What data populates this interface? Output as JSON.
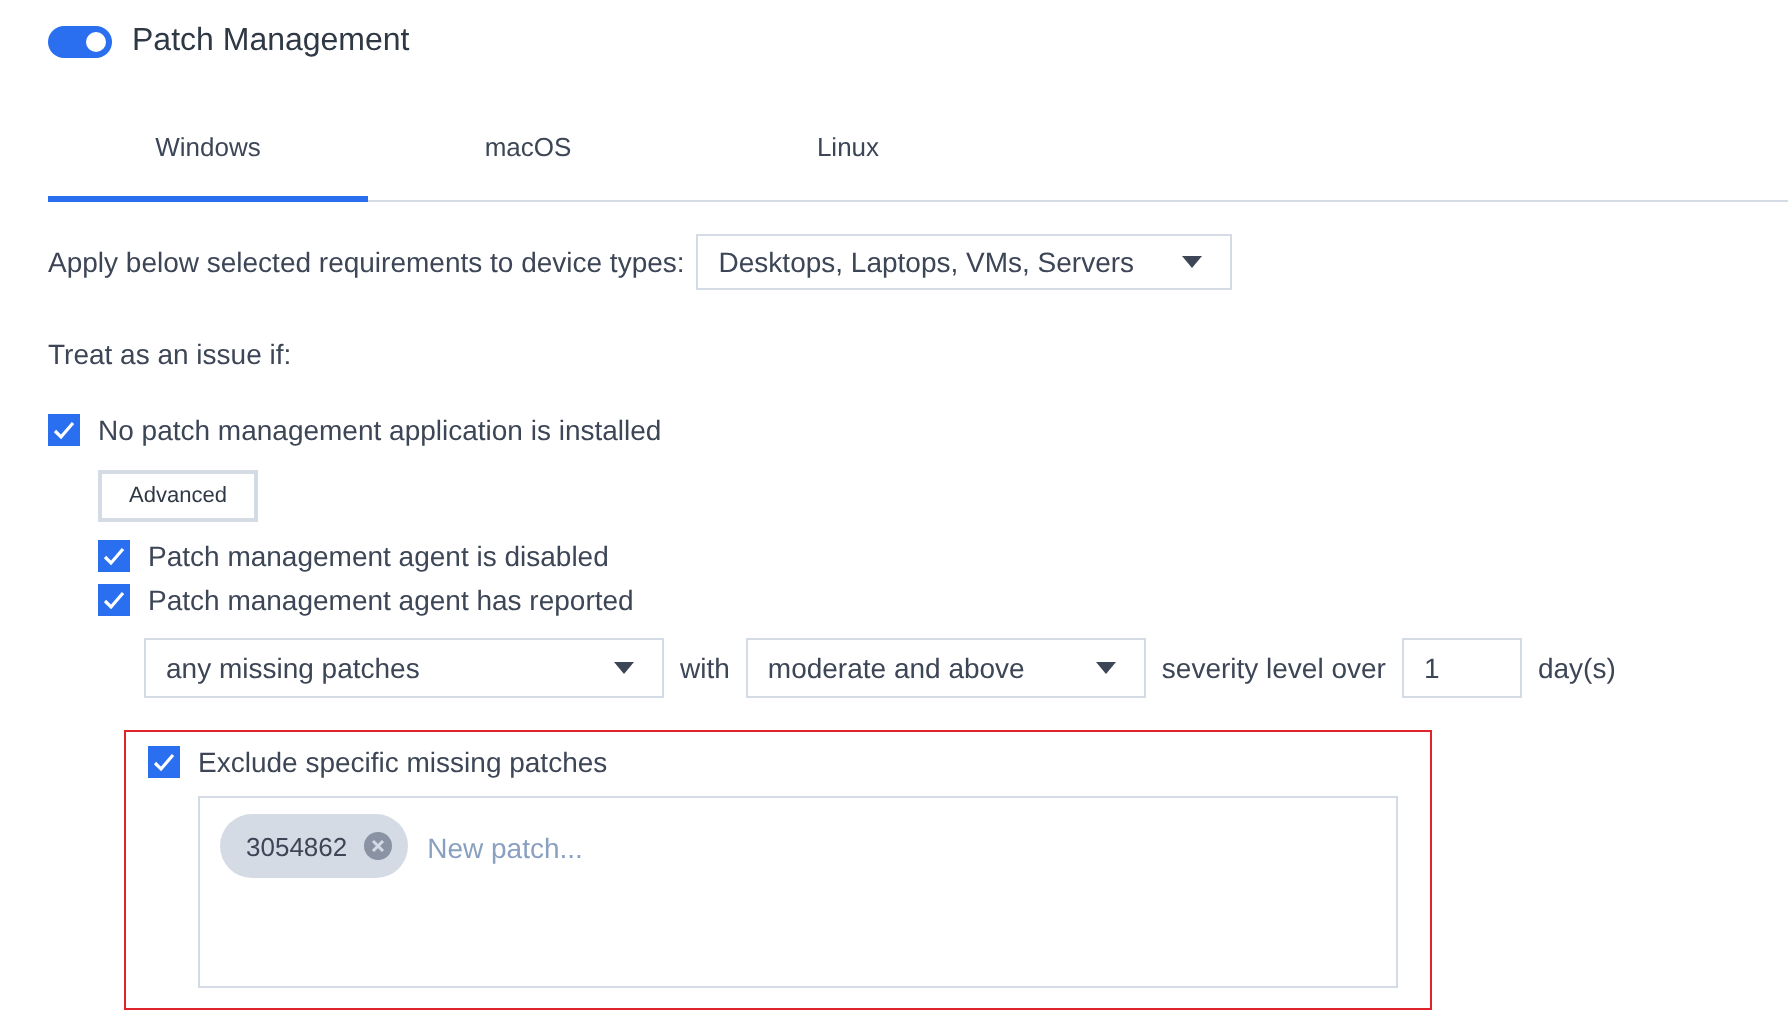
{
  "header": {
    "toggle_on": true,
    "title": "Patch Management"
  },
  "tabs": [
    {
      "label": "Windows",
      "selected": true
    },
    {
      "label": "macOS",
      "selected": false
    },
    {
      "label": "Linux",
      "selected": false
    }
  ],
  "device_types": {
    "label": "Apply below selected requirements to device types:",
    "value": "Desktops, Laptops, VMs, Servers"
  },
  "treat_label": "Treat as an issue if:",
  "main_check": {
    "label": "No patch management application is installed",
    "checked": true
  },
  "advanced_button": "Advanced",
  "sub_checks": [
    {
      "label": "Patch management agent is disabled",
      "checked": true
    },
    {
      "label": "Patch management agent has reported",
      "checked": true
    }
  ],
  "condition": {
    "patches_select": "any missing patches",
    "with": "with",
    "severity_select": "moderate and above",
    "severity_label": "severity level over",
    "days_value": "1",
    "days_unit": "day(s)"
  },
  "exclusion": {
    "highlighted": true,
    "checked": true,
    "label": "Exclude specific missing patches",
    "tags": [
      "3054862"
    ],
    "placeholder": "New patch..."
  }
}
